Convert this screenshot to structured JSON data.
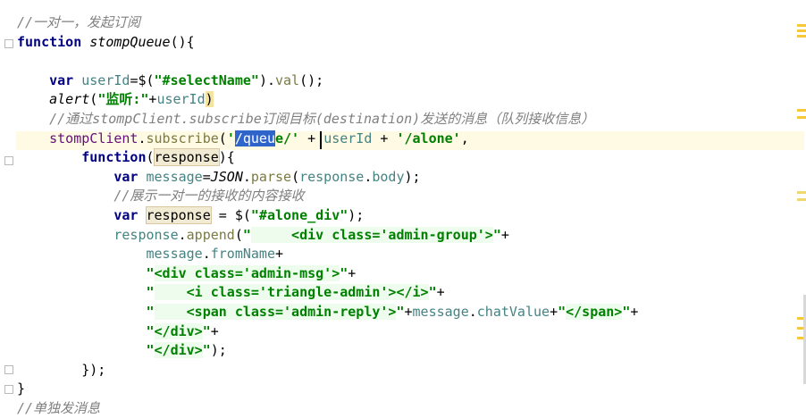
{
  "editor": {
    "lines": [
      {
        "tokens": [
          {
            "t": "//一对一，发起订阅",
            "c": "cm"
          }
        ]
      },
      {
        "tokens": [
          {
            "t": "function",
            "c": "kw"
          },
          {
            "t": " "
          },
          {
            "t": "stompQueue",
            "c": "fn"
          },
          {
            "t": "(){"
          }
        ]
      },
      {
        "tokens": []
      },
      {
        "tokens": [
          {
            "t": "    "
          },
          {
            "t": "var",
            "c": "kw"
          },
          {
            "t": " "
          },
          {
            "t": "userId",
            "c": "var"
          },
          {
            "t": "=$("
          },
          {
            "t": "\"#selectName\"",
            "c": "str"
          },
          {
            "t": ")."
          },
          {
            "t": "val",
            "c": "meth"
          },
          {
            "t": "();"
          }
        ]
      },
      {
        "tokens": [
          {
            "t": "    "
          },
          {
            "t": "alert",
            "c": "fn"
          },
          {
            "t": "("
          },
          {
            "t": "\"监听:\"",
            "c": "str"
          },
          {
            "t": "+"
          },
          {
            "t": "userId",
            "c": "var"
          },
          {
            "t": ")",
            "c": "brace"
          }
        ]
      },
      {
        "tokens": [
          {
            "t": "    "
          },
          {
            "t": "//通过stompClient.subscribe订阅目标(destination)发送的消息（队列接收信息）",
            "c": "cm"
          }
        ]
      },
      {
        "tokens": [
          {
            "t": "    "
          },
          {
            "t": "stompClient",
            "c": "mem"
          },
          {
            "t": "."
          },
          {
            "t": "subscribe",
            "c": "meth"
          },
          {
            "t": "("
          },
          {
            "t": "'",
            "c": "str"
          },
          {
            "t": "/queu",
            "c": "sel"
          },
          {
            "t": "e/'",
            "c": "str"
          },
          {
            "t": " + "
          },
          {
            "t": "userId",
            "c": "var"
          },
          {
            "t": " + "
          },
          {
            "t": "'/alone'",
            "c": "str"
          },
          {
            "t": ","
          }
        ]
      },
      {
        "tokens": [
          {
            "t": "        "
          },
          {
            "t": "function",
            "c": "kw"
          },
          {
            "t": "("
          },
          {
            "t": "response",
            "c": "usage"
          },
          {
            "t": "){"
          }
        ]
      },
      {
        "tokens": [
          {
            "t": "            "
          },
          {
            "t": "var",
            "c": "kw"
          },
          {
            "t": " "
          },
          {
            "t": "message",
            "c": "var"
          },
          {
            "t": "="
          },
          {
            "t": "JSON",
            "c": "fn"
          },
          {
            "t": "."
          },
          {
            "t": "parse",
            "c": "meth"
          },
          {
            "t": "("
          },
          {
            "t": "response",
            "c": "var"
          },
          {
            "t": "."
          },
          {
            "t": "body",
            "c": "var"
          },
          {
            "t": ");"
          }
        ]
      },
      {
        "tokens": [
          {
            "t": "            "
          },
          {
            "t": "//展示一对一的接收的内容接收",
            "c": "cm"
          }
        ]
      },
      {
        "tokens": [
          {
            "t": "            "
          },
          {
            "t": "var",
            "c": "kw"
          },
          {
            "t": " "
          },
          {
            "t": "response",
            "c": "usage"
          },
          {
            "t": " = $("
          },
          {
            "t": "\"#alone_div\"",
            "c": "str"
          },
          {
            "t": ");"
          }
        ]
      },
      {
        "tokens": [
          {
            "t": "            "
          },
          {
            "t": "response",
            "c": "var"
          },
          {
            "t": "."
          },
          {
            "t": "append",
            "c": "meth"
          },
          {
            "t": "("
          },
          {
            "t": "\"",
            "c": "str"
          },
          {
            "t": "     <div class='admin-group'>",
            "c": "strhl"
          },
          {
            "t": "\"",
            "c": "str"
          },
          {
            "t": "+"
          }
        ]
      },
      {
        "tokens": [
          {
            "t": "                "
          },
          {
            "t": "message",
            "c": "var"
          },
          {
            "t": "."
          },
          {
            "t": "fromName",
            "c": "var"
          },
          {
            "t": "+"
          }
        ]
      },
      {
        "tokens": [
          {
            "t": "                "
          },
          {
            "t": "\"",
            "c": "str"
          },
          {
            "t": "<div class='admin-msg'>",
            "c": "strhl"
          },
          {
            "t": "\"",
            "c": "str"
          },
          {
            "t": "+"
          }
        ]
      },
      {
        "tokens": [
          {
            "t": "                "
          },
          {
            "t": "\"",
            "c": "str"
          },
          {
            "t": "    <i class='triangle-admin'></i>",
            "c": "strhl"
          },
          {
            "t": "\"",
            "c": "str"
          },
          {
            "t": "+"
          }
        ]
      },
      {
        "tokens": [
          {
            "t": "                "
          },
          {
            "t": "\"",
            "c": "str"
          },
          {
            "t": "    <span class='admin-reply'>",
            "c": "strhl"
          },
          {
            "t": "\"",
            "c": "str"
          },
          {
            "t": "+"
          },
          {
            "t": "message",
            "c": "var"
          },
          {
            "t": "."
          },
          {
            "t": "chatValue",
            "c": "var"
          },
          {
            "t": "+"
          },
          {
            "t": "\"",
            "c": "str"
          },
          {
            "t": "</span>",
            "c": "strhl"
          },
          {
            "t": "\"",
            "c": "str"
          },
          {
            "t": "+"
          }
        ]
      },
      {
        "tokens": [
          {
            "t": "                "
          },
          {
            "t": "\"",
            "c": "str"
          },
          {
            "t": "</div>",
            "c": "strhl"
          },
          {
            "t": "\"",
            "c": "str"
          },
          {
            "t": "+"
          }
        ]
      },
      {
        "tokens": [
          {
            "t": "                "
          },
          {
            "t": "\"",
            "c": "str"
          },
          {
            "t": "</div>",
            "c": "strhl"
          },
          {
            "t": "\"",
            "c": "str"
          },
          {
            "t": ");"
          }
        ]
      },
      {
        "tokens": [
          {
            "t": "        "
          },
          {
            "t": "});"
          }
        ]
      },
      {
        "tokens": [
          {
            "t": "}"
          }
        ]
      },
      {
        "tokens": [
          {
            "t": "//单独发消息",
            "c": "cm"
          }
        ]
      }
    ],
    "colors": {
      "keyword": "#000080",
      "string": "#008000",
      "comment": "#808080",
      "variable": "#458383",
      "selection": "#2f65ca",
      "caret_line": "#fffae3"
    }
  }
}
